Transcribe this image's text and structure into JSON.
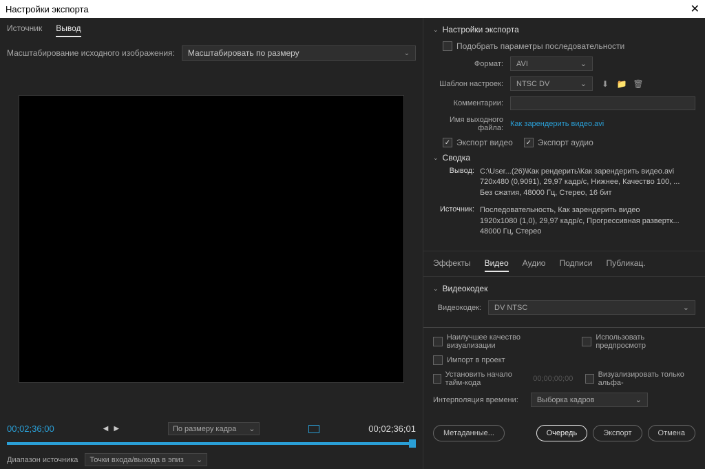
{
  "title": "Настройки экспорта",
  "leftTabs": {
    "source": "Источник",
    "output": "Вывод"
  },
  "scale": {
    "label": "Масштабирование исходного изображения:",
    "value": "Масштабировать по размеру"
  },
  "timeline": {
    "in": "00;02;36;00",
    "out": "00;02;36;01",
    "fit": "По размеру кадра",
    "rangeLabel": "Диапазон источника",
    "rangeValue": "Точки входа/выхода в эпиз"
  },
  "exportSettings": {
    "title": "Настройки экспорта",
    "matchSeq": "Подобрать параметры последовательности",
    "formatLabel": "Формат:",
    "formatValue": "AVI",
    "presetLabel": "Шаблон настроек:",
    "presetValue": "NTSC DV",
    "commentsLabel": "Комментарии:",
    "outNameLabel": "Имя выходного файла:",
    "outNameValue": "Как зарендерить видео.avi",
    "exportVideo": "Экспорт видео",
    "exportAudio": "Экспорт аудио"
  },
  "summary": {
    "title": "Сводка",
    "outLabel": "Вывод:",
    "outText": "C:\\User...(26)\\Как рендерить\\Как зарендерить видео.avi\n720x480 (0,9091), 29,97 кадр/с, Нижнее, Качество 100, ...\nБез сжатия, 48000 Гц, Стерео, 16 бит",
    "srcLabel": "Источник:",
    "srcText": "Последовательность, Как зарендерить видео\n1920x1080 (1,0), 29,97 кадр/с, Прогрессивная развертк...\n48000 Гц, Стерео"
  },
  "tabs2": {
    "effects": "Эффекты",
    "video": "Видео",
    "audio": "Аудио",
    "captions": "Подписи",
    "publish": "Публикац."
  },
  "codec": {
    "title": "Видеокодек",
    "label": "Видеокодек:",
    "value": "DV NTSC"
  },
  "bottom": {
    "maxQuality": "Наилучшее качество визуализации",
    "usePreviews": "Использовать предпросмотр",
    "importProj": "Импорт в проект",
    "setTimecode": "Установить начало тайм-кода",
    "timecodeVal": "00;00;00;00",
    "alphaOnly": "Визуализировать только альфа-",
    "interpLabel": "Интерполяция времени:",
    "interpValue": "Выборка кадров"
  },
  "buttons": {
    "metadata": "Метаданные...",
    "queue": "Очередь",
    "export": "Экспорт",
    "cancel": "Отмена"
  }
}
